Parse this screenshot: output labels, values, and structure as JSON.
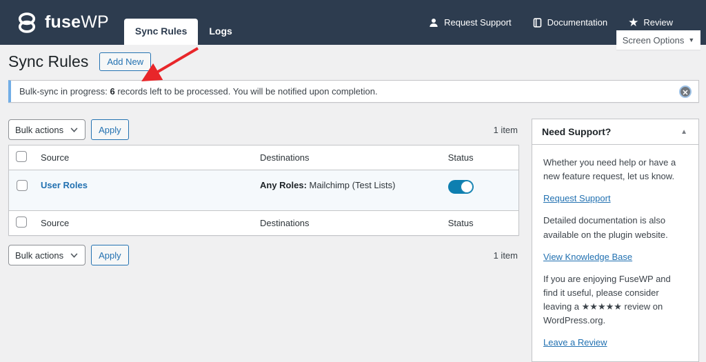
{
  "header": {
    "brand_bold": "fuse",
    "brand_light": "WP",
    "tabs": [
      {
        "label": "Sync Rules",
        "active": true
      },
      {
        "label": "Logs",
        "active": false
      }
    ],
    "nav": {
      "support_label": "Request Support",
      "docs_label": "Documentation",
      "review_label": "Review",
      "star_glyph": "★"
    }
  },
  "screen_options": {
    "label": "Screen Options",
    "caret": "▼"
  },
  "page": {
    "title": "Sync Rules",
    "add_new_label": "Add New"
  },
  "notice": {
    "prefix": "Bulk-sync in progress: ",
    "count": "6",
    "suffix": " records left to be processed. You will be notified upon completion.",
    "dismiss_glyph": "✕"
  },
  "toolbar": {
    "bulk_actions_label": "Bulk actions",
    "apply_label": "Apply",
    "item_count_top": "1 item",
    "item_count_bottom": "1 item"
  },
  "table": {
    "columns": {
      "source": "Source",
      "destinations": "Destinations",
      "status": "Status"
    },
    "rows": [
      {
        "source": "User Roles",
        "destination_bold": "Any Roles:",
        "destination_rest": " Mailchimp (Test Lists)",
        "status_on": true
      }
    ]
  },
  "sidebar": {
    "title": "Need Support?",
    "collapse_glyph": "▲",
    "paragraph1": "Whether you need help or have a new feature request, let us know.",
    "link1": "Request Support",
    "paragraph2": "Detailed documentation is also available on the plugin website.",
    "link2": "View Knowledge Base",
    "paragraph3": "If you are enjoying FuseWP and find it useful, please consider leaving a ★★★★★ review on WordPress.org.",
    "link3": "Leave a Review"
  },
  "colors": {
    "header_bg": "#2d3c4f",
    "page_bg": "#f0f0f1",
    "accent_blue": "#2271b1",
    "toggle_on": "#0e7fb0",
    "notice_border": "#72aee6",
    "annotation_red": "#e8262a"
  }
}
